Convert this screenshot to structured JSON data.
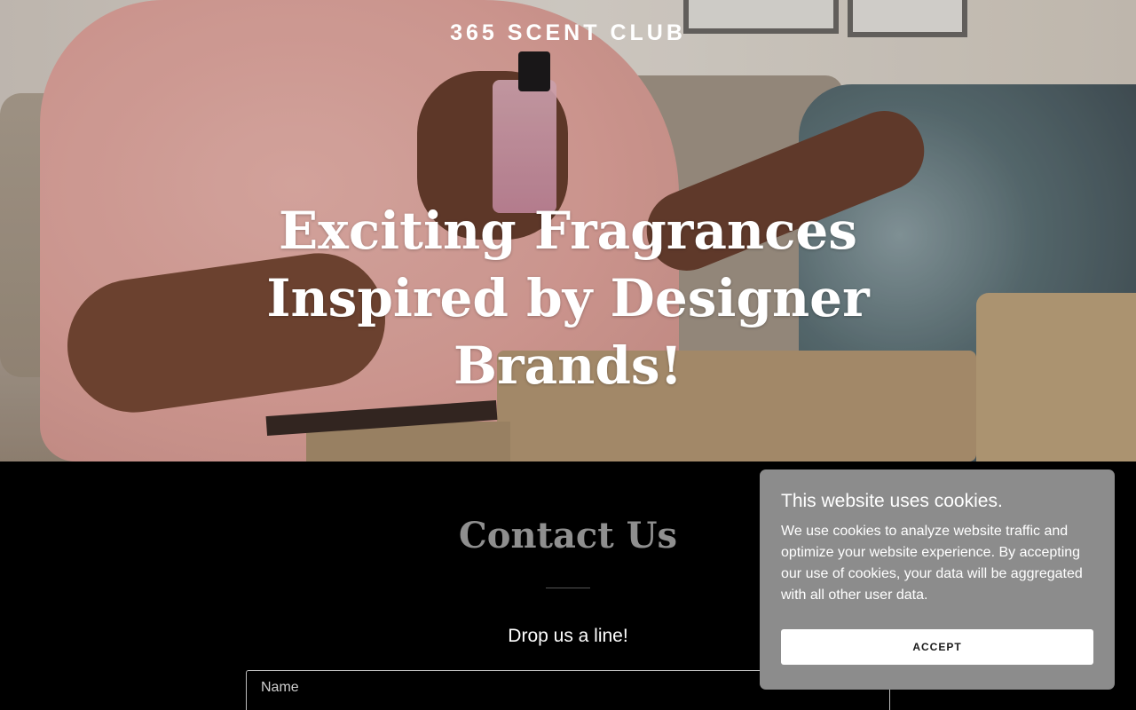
{
  "header": {
    "brand": "365 SCENT CLUB"
  },
  "hero": {
    "headline": "Exciting Fragrances Inspired by Designer Brands!",
    "image": "woman-spraying-perfume-photo"
  },
  "contact": {
    "title": "Contact Us",
    "subtitle": "Drop us a line!",
    "name_placeholder": "Name"
  },
  "cookie_banner": {
    "title": "This website uses cookies.",
    "text": "We use cookies to analyze website traffic and optimize your website experience. By accepting our use of cookies, your data will be aggregated with all other user data.",
    "accept_label": "ACCEPT"
  },
  "colors": {
    "page_background": "#000000",
    "banner_background": "#8c8c8c",
    "contact_title": "#8f8f8f"
  }
}
